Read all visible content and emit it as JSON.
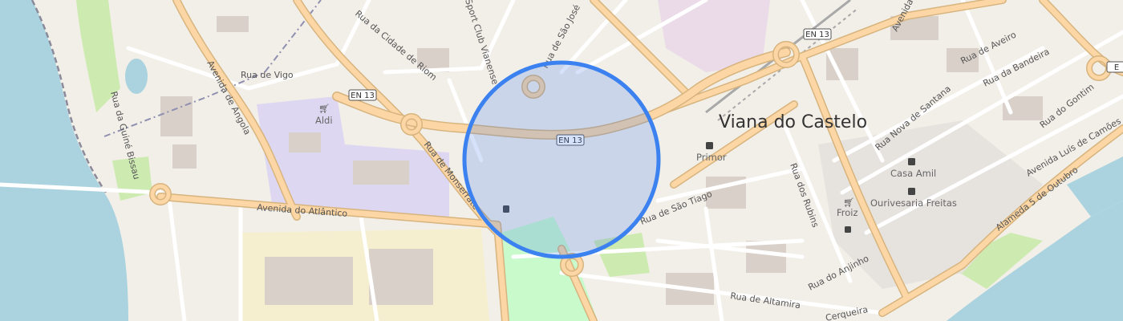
{
  "map": {
    "place_label": "Viana do Castelo",
    "shield_label": "EN 13",
    "colors": {
      "water": "#aad3df",
      "land": "#f2efe9",
      "major_road": "#fcd6a4",
      "major_road_casing": "#d7b47e",
      "industrial": "#ebdbe8",
      "school": "#ddd7f1",
      "park": "#c8facc",
      "residential": "#e0dfdf",
      "accuracy_fill": "rgba(65,125,230,0.22)",
      "accuracy_stroke": "#3b82f0"
    },
    "street_labels": [
      "Rua da Guiné Bissau",
      "Avenida de Angola",
      "Rua de Vigo",
      "Rua da Cidade de Riom",
      "Sport Club Vianense",
      "Rua de São José",
      "Rua de Monserrate",
      "Avenida do Atlântico",
      "Rua de São Tiago",
      "Rua dos Rubins",
      "Rua do Anjinho",
      "Rua de Altamira",
      "Rua Nova de Santana",
      "Rua de Aveiro",
      "Rua da Bandeira",
      "Rua do Gontim",
      "Avenida Luís de Camões",
      "Alameda 5 de Outubro",
      "Avenida",
      "Cerqueira"
    ],
    "pois": [
      {
        "label": "Aldi",
        "icon": "cart-icon"
      },
      {
        "label": "Primor",
        "icon": "shopping-bag-icon"
      },
      {
        "label": "Casa Amil",
        "icon": "shopping-bag-icon"
      },
      {
        "label": "Ourivesaria Freitas",
        "icon": "shopping-bag-icon"
      },
      {
        "label": "Froiz",
        "icon": "cart-icon"
      }
    ]
  }
}
